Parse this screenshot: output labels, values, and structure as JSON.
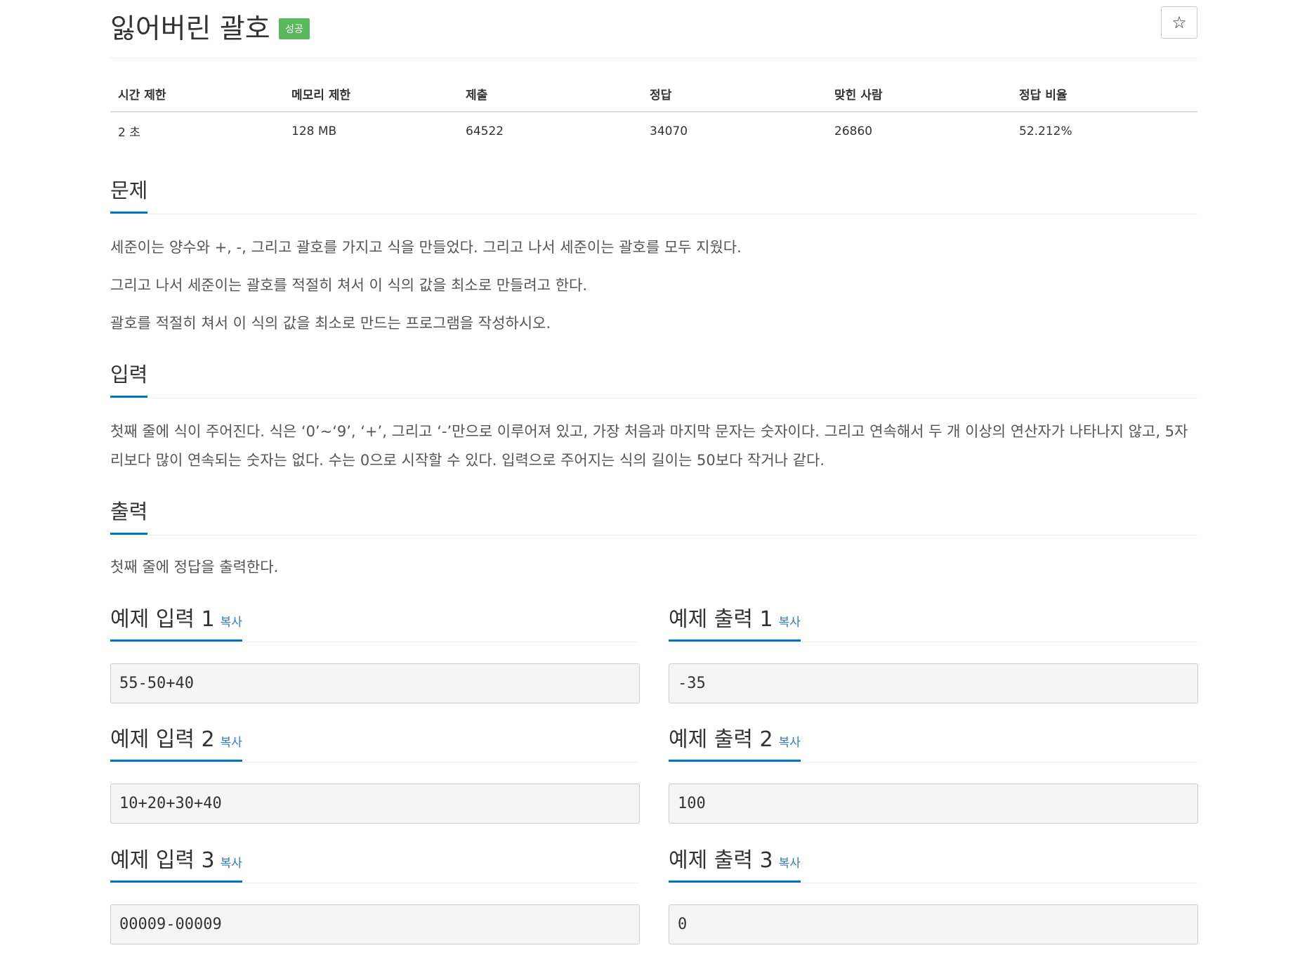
{
  "problem": {
    "title": "잃어버린 괄호",
    "badge": "성공",
    "star": "☆"
  },
  "info": {
    "headers": [
      "시간 제한",
      "메모리 제한",
      "제출",
      "정답",
      "맞힌 사람",
      "정답 비율"
    ],
    "values": [
      "2 초",
      "128 MB",
      "64522",
      "34070",
      "26860",
      "52.212%"
    ]
  },
  "sections": {
    "description": {
      "title": "문제",
      "paragraphs": [
        "세준이는 양수와 +, -, 그리고 괄호를 가지고 식을 만들었다. 그리고 나서 세준이는 괄호를 모두 지웠다.",
        "그리고 나서 세준이는 괄호를 적절히 쳐서 이 식의 값을 최소로 만들려고 한다.",
        "괄호를 적절히 쳐서 이 식의 값을 최소로 만드는 프로그램을 작성하시오."
      ]
    },
    "input": {
      "title": "입력",
      "text": "첫째 줄에 식이 주어진다. 식은 ‘0’~‘9’, ‘+’, 그리고 ‘-’만으로 이루어져 있고, 가장 처음과 마지막 문자는 숫자이다. 그리고 연속해서 두 개 이상의 연산자가 나타나지 않고, 5자리보다 많이 연속되는 숫자는 없다. 수는 0으로 시작할 수 있다. 입력으로 주어지는 식의 길이는 50보다 작거나 같다."
    },
    "output": {
      "title": "출력",
      "text": "첫째 줄에 정답을 출력한다."
    }
  },
  "examples": [
    {
      "input_title": "예제 입력 1",
      "output_title": "예제 출력 1",
      "copy": "복사",
      "input": "55-50+40",
      "output": "-35"
    },
    {
      "input_title": "예제 입력 2",
      "output_title": "예제 출력 2",
      "copy": "복사",
      "input": "10+20+30+40",
      "output": "100"
    },
    {
      "input_title": "예제 입력 3",
      "output_title": "예제 출력 3",
      "copy": "복사",
      "input": "00009-00009",
      "output": "0"
    }
  ]
}
